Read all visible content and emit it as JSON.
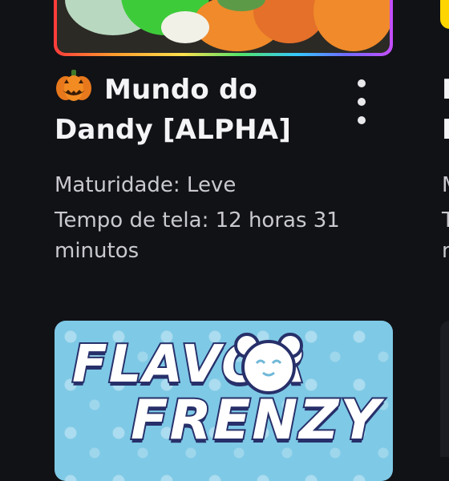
{
  "game_card_1": {
    "title": "Mundo do Dandy [ALPHA]",
    "title_icon": "pumpkin-icon",
    "maturity": "Maturidade: Leve",
    "screen_time": "Tempo de tela: 12 horas 31 minutos",
    "menu_icon": "more-vertical-icon"
  },
  "game_card_2": {
    "thumbnail_text_line1": "FLAVOR",
    "thumbnail_text_line2": "FRENZY"
  },
  "colors": {
    "background": "#111216",
    "text_primary": "#f4f4f6",
    "text_secondary": "#c9c9cf"
  }
}
